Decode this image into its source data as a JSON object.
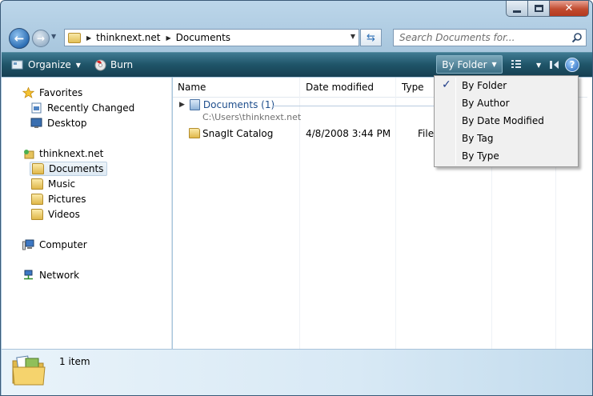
{
  "window": {
    "buttons": {
      "minimize": "minimize",
      "maximize": "maximize",
      "close": "close"
    }
  },
  "address": {
    "crumbs": [
      "thinknext.net",
      "Documents"
    ]
  },
  "search": {
    "placeholder": "Search Documents for..."
  },
  "toolbar": {
    "organize_label": "Organize",
    "burn_label": "Burn",
    "byfolder_label": "By Folder"
  },
  "nav": {
    "favorites": "Favorites",
    "recently_changed": "Recently Changed",
    "desktop": "Desktop",
    "user": "thinknext.net",
    "documents": "Documents",
    "music": "Music",
    "pictures": "Pictures",
    "videos": "Videos",
    "computer": "Computer",
    "network": "Network"
  },
  "columns": {
    "name": "Name",
    "date": "Date modified",
    "type": "Type"
  },
  "group": {
    "title": "Documents (1)",
    "path": "C:\\Users\\thinknext.net"
  },
  "rows": [
    {
      "name": "SnagIt Catalog",
      "date": "4/8/2008 3:44 PM",
      "type": "File Folder"
    }
  ],
  "status": {
    "text": "1 item"
  },
  "menu": {
    "items": [
      "By Folder",
      "By Author",
      "By Date Modified",
      "By Tag",
      "By Type"
    ],
    "checked": "By Folder"
  },
  "colors": {
    "toolbar": "#1f5468",
    "link": "#1e4e8c",
    "accent": "#2d6fb5"
  }
}
